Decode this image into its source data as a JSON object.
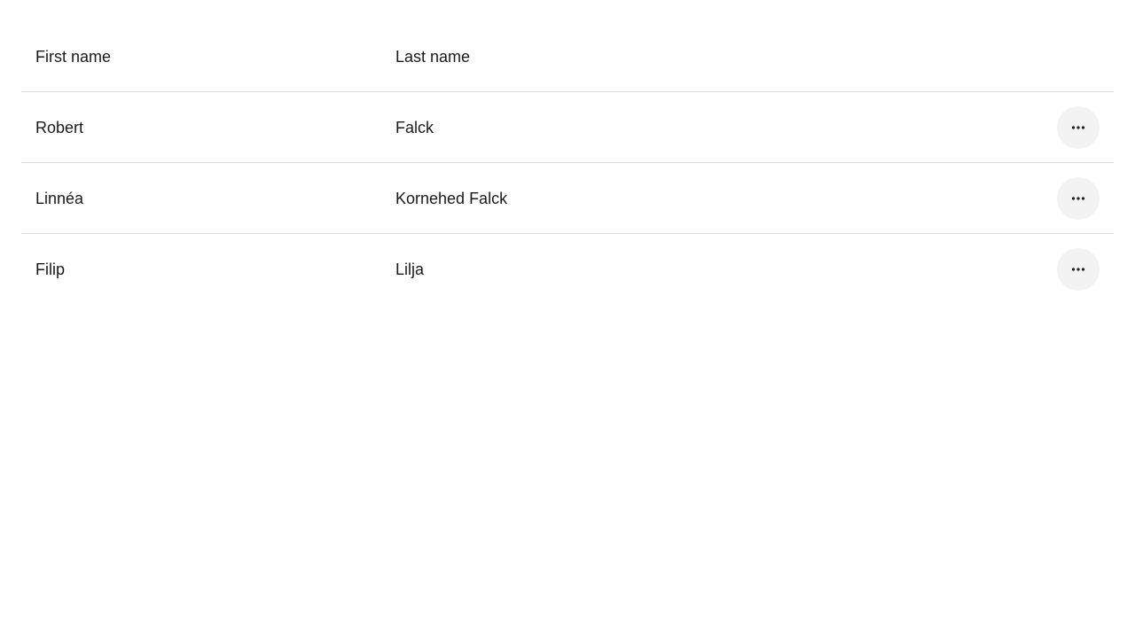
{
  "table": {
    "headers": {
      "first_name": "First name",
      "last_name": "Last name"
    },
    "rows": [
      {
        "first_name": "Robert",
        "last_name": "Falck",
        "action_icon": "more-horizontal-icon"
      },
      {
        "first_name": "Linnéa",
        "last_name": "Kornehed Falck",
        "action_icon": "more-horizontal-icon"
      },
      {
        "first_name": "Filip",
        "last_name": "Lilja",
        "action_icon": "more-horizontal-icon"
      }
    ]
  },
  "colors": {
    "text": "#1a1a1a",
    "divider": "#dcdcdc",
    "action_button_bg": "#f2f2f2"
  }
}
